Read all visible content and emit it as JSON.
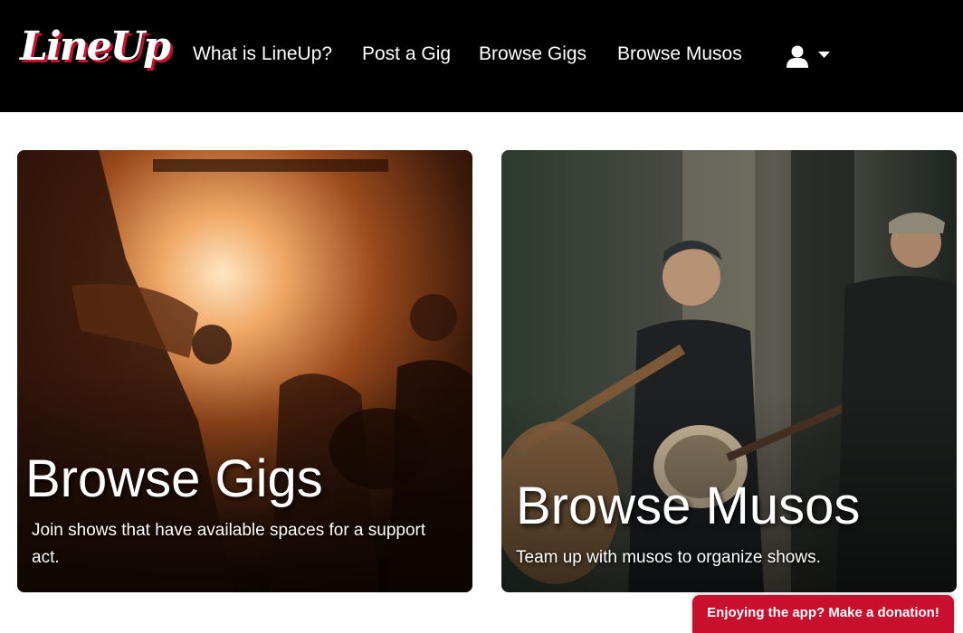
{
  "brand": {
    "logo_text": "LineUp",
    "accent_color": "#c8102e"
  },
  "nav": {
    "items": [
      {
        "label": "What is LineUp?"
      },
      {
        "label": "Post a Gig"
      },
      {
        "label": "Browse Gigs"
      },
      {
        "label": "Browse Musos"
      }
    ],
    "user_icon": "user-icon",
    "dropdown_icon": "caret-down-icon"
  },
  "cards": [
    {
      "title": "Browse Gigs",
      "description": "Join shows that have available spaces for a support act.",
      "image": "concert-crowd-photo"
    },
    {
      "title": "Browse Musos",
      "description": "Team up with musos to organize shows.",
      "image": "street-musicians-photo"
    }
  ],
  "donate_button": {
    "label": "Enjoying the app? Make a donation!"
  }
}
